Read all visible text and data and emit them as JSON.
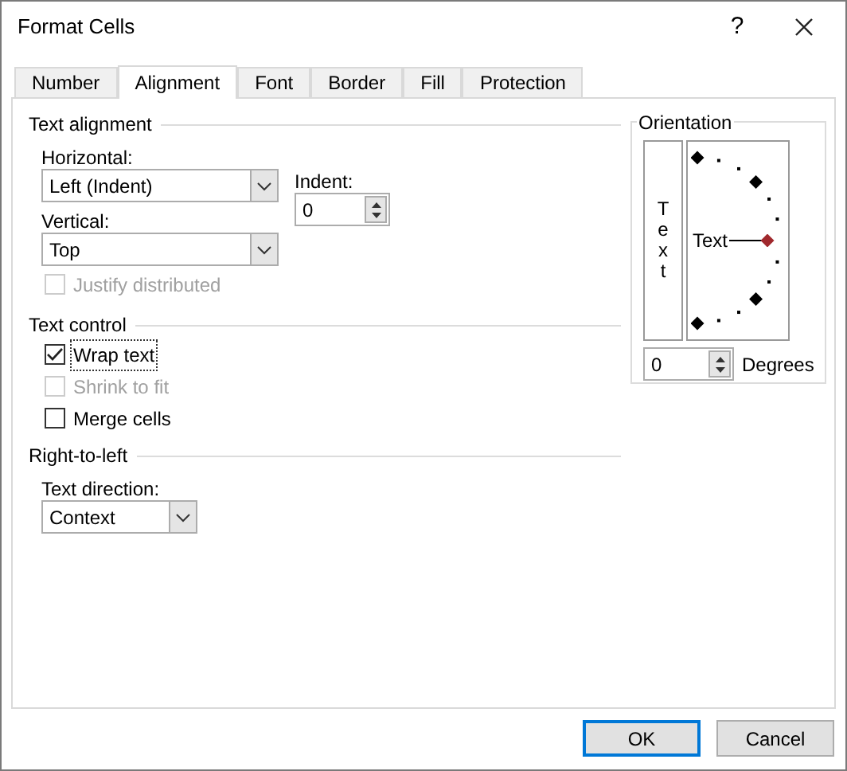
{
  "window": {
    "title": "Format Cells",
    "help": "?"
  },
  "tabs": [
    {
      "label": "Number",
      "selected": false
    },
    {
      "label": "Alignment",
      "selected": true
    },
    {
      "label": "Font",
      "selected": false
    },
    {
      "label": "Border",
      "selected": false
    },
    {
      "label": "Fill",
      "selected": false
    },
    {
      "label": "Protection",
      "selected": false
    }
  ],
  "text_alignment": {
    "legend": "Text alignment",
    "horizontal": {
      "label": "Horizontal:",
      "value": "Left (Indent)"
    },
    "vertical": {
      "label": "Vertical:",
      "value": "Top"
    },
    "indent": {
      "label": "Indent:",
      "value": "0"
    },
    "justify": {
      "label": "Justify distributed",
      "checked": false,
      "disabled": true
    }
  },
  "text_control": {
    "legend": "Text control",
    "options": [
      {
        "label": "Wrap text",
        "checked": true,
        "disabled": false,
        "focused": true
      },
      {
        "label": "Shrink to fit",
        "checked": false,
        "disabled": true,
        "focused": false
      },
      {
        "label": "Merge cells",
        "checked": false,
        "disabled": false,
        "focused": false
      }
    ]
  },
  "right_to_left": {
    "legend": "Right-to-left",
    "direction": {
      "label": "Text direction:",
      "value": "Context"
    }
  },
  "orientation": {
    "legend": "Orientation",
    "vertical_text": "Text",
    "dial_text": "Text",
    "degrees": {
      "value": "0",
      "label": "Degrees"
    }
  },
  "buttons": [
    {
      "label": "OK",
      "default": true
    },
    {
      "label": "Cancel",
      "default": false
    }
  ]
}
